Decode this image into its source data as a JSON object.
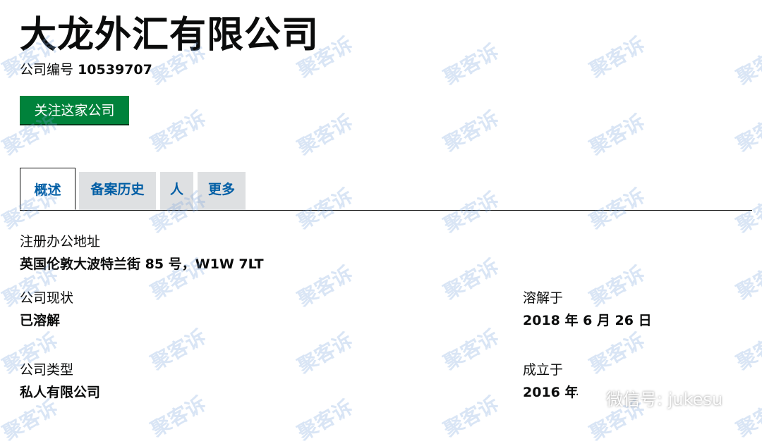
{
  "company": {
    "name": "大龙外汇有限公司",
    "number_label": "公司编号",
    "number": "10539707"
  },
  "follow_button": "关注这家公司",
  "tabs": [
    {
      "label": "概述",
      "active": true
    },
    {
      "label": "备案历史",
      "active": false
    },
    {
      "label": "人",
      "active": false
    },
    {
      "label": "更多",
      "active": false
    }
  ],
  "fields": {
    "registered_office": {
      "label": "注册办公地址",
      "value": "英国伦敦大波特兰街 85 号，W1W 7LT"
    },
    "status": {
      "label": "公司现状",
      "value": "已溶解"
    },
    "dissolved_on": {
      "label": "溶解于",
      "value": "2018 年 6 月 26 日"
    },
    "type": {
      "label": "公司类型",
      "value": "私人有限公司"
    },
    "incorporated_on": {
      "label": "成立于",
      "value": "2016 年"
    }
  },
  "watermark": {
    "text": "聚客诉",
    "account": "微信号: jukesu"
  },
  "colors": {
    "button": "#00823b",
    "link": "#005ea5",
    "tab_inactive": "#dee0e2",
    "text": "#0b0c0c"
  }
}
